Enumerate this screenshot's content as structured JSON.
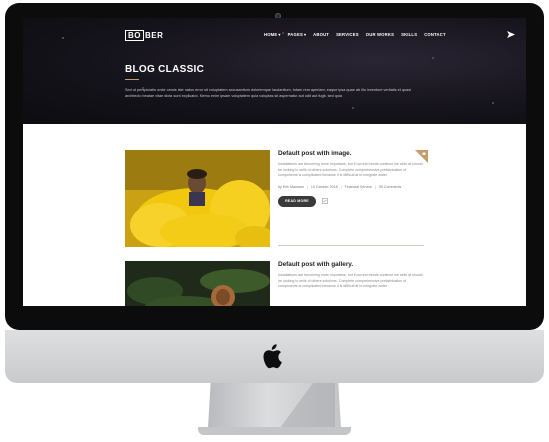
{
  "site": {
    "logo_box": "BO",
    "logo_rest": "BER",
    "nav": [
      {
        "label": "HOME",
        "has_menu": true
      },
      {
        "label": "PAGES",
        "has_menu": true
      },
      {
        "label": "ABOUT",
        "has_menu": false
      },
      {
        "label": "SERVICES",
        "has_menu": false
      },
      {
        "label": "OUR WORKS",
        "has_menu": false
      },
      {
        "label": "SKILLS",
        "has_menu": false
      },
      {
        "label": "CONTACT",
        "has_menu": false
      }
    ],
    "nav_chevron": "▾"
  },
  "hero": {
    "title": "BLOG CLASSIC",
    "description": "Sed ut perspiciatis unde omnis iste natus error sit voluptatem accusantium doloremque laudantium, totam rem aperiam, eaque ipsa quae ab illo inventore veritatis et quasi architecto beatae vitae dicta sunt explicabo. Nemo enim ipsam voluptatem quia voluptas sit aspernatur aut odit aut fugit, sed quia"
  },
  "posts": [
    {
      "title": "Default post with image.",
      "excerpt": "Installations are becoming more importans, but if current trends continue we sells at should be looking to sells of others solutions. Complete comprehensive prefabrication of components is complicated because it is difficult at to integrate wider.",
      "author": "by Erik Mamann",
      "date": "10 October 2018",
      "category": "Financial Service",
      "comments": "05 Comments",
      "read_more": "READ MORE"
    },
    {
      "title": "Default post with gallery.",
      "excerpt": "Installations are becoming more importans, but if current trends continue we sells at should be looking to sells of others solutions. Complete comprehensive prefabrication of components is complicated because it is difficult at to integrate wider."
    }
  ],
  "colors": {
    "accent": "#c79a6a",
    "hero_bg": "#15131b",
    "button": "#3a3a3a",
    "smoke_yellow": "#f2c80f"
  },
  "icons": {
    "share": "share-icon",
    "corner": "format-image-icon",
    "apple": "apple-logo-icon"
  }
}
